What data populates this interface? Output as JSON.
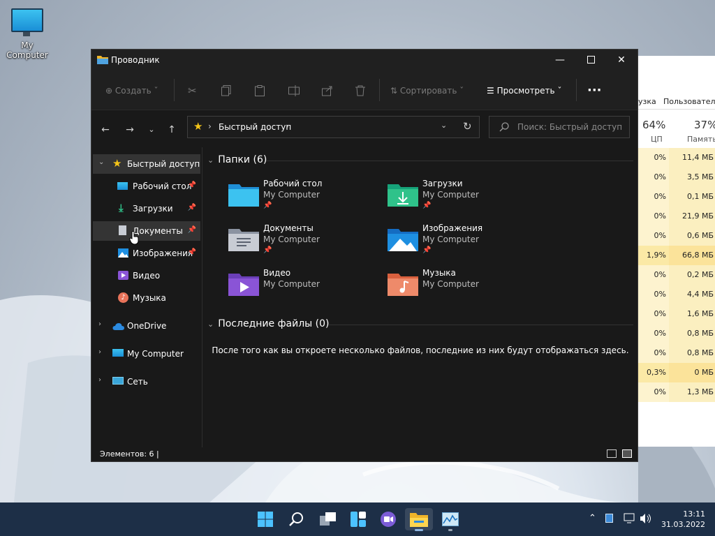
{
  "desktop": {
    "icon_label": "My Computer"
  },
  "taskmgr": {
    "headers": [
      "узка",
      "Пользовател"
    ],
    "cpu_pct": "64%",
    "cpu_label": "ЦП",
    "mem_pct": "37%",
    "mem_label": "Память",
    "rows": [
      {
        "cpu": "0%",
        "mem": "11,4 МБ"
      },
      {
        "cpu": "0%",
        "mem": "3,5 МБ"
      },
      {
        "cpu": "0%",
        "mem": "0,1 МБ"
      },
      {
        "cpu": "0%",
        "mem": "21,9 МБ"
      },
      {
        "cpu": "0%",
        "mem": "0,6 МБ"
      },
      {
        "cpu": "1,9%",
        "mem": "66,8 МБ"
      },
      {
        "cpu": "0%",
        "mem": "0,2 МБ"
      },
      {
        "cpu": "0%",
        "mem": "4,4 МБ"
      },
      {
        "cpu": "0%",
        "mem": "1,6 МБ"
      },
      {
        "cpu": "0%",
        "mem": "0,8 МБ"
      },
      {
        "cpu": "0%",
        "mem": "0,8 МБ"
      },
      {
        "cpu": "0,3%",
        "mem": "0 МБ"
      },
      {
        "cpu": "0%",
        "mem": "1,3 МБ"
      }
    ]
  },
  "explorer": {
    "title": "Проводник",
    "toolbar": {
      "create": "Создать",
      "sort": "Сортировать",
      "view": "Просмотреть",
      "more": "···"
    },
    "address": {
      "path": "Быстрый доступ"
    },
    "search": {
      "placeholder": "Поиск: Быстрый доступ"
    },
    "nav": {
      "quick_access": "Быстрый доступ",
      "items": [
        "Рабочий стол",
        "Загрузки",
        "Документы",
        "Изображения",
        "Видео",
        "Музыка"
      ],
      "onedrive": "OneDrive",
      "computer": "My Computer",
      "network": "Сеть"
    },
    "folders_header": "Папки (6)",
    "folders": [
      {
        "name": "Рабочий стол",
        "loc": "My Computer"
      },
      {
        "name": "Загрузки",
        "loc": "My Computer"
      },
      {
        "name": "Документы",
        "loc": "My Computer"
      },
      {
        "name": "Изображения",
        "loc": "My Computer"
      },
      {
        "name": "Видео",
        "loc": "My Computer"
      },
      {
        "name": "Музыка",
        "loc": "My Computer"
      }
    ],
    "recent_header": "Последние файлы (0)",
    "recent_empty": "После того как вы откроете несколько файлов, последние из них будут отображаться здесь.",
    "status": "Элементов: 6   |"
  },
  "taskbar": {
    "time": "13:11",
    "date": "31.03.2022"
  }
}
